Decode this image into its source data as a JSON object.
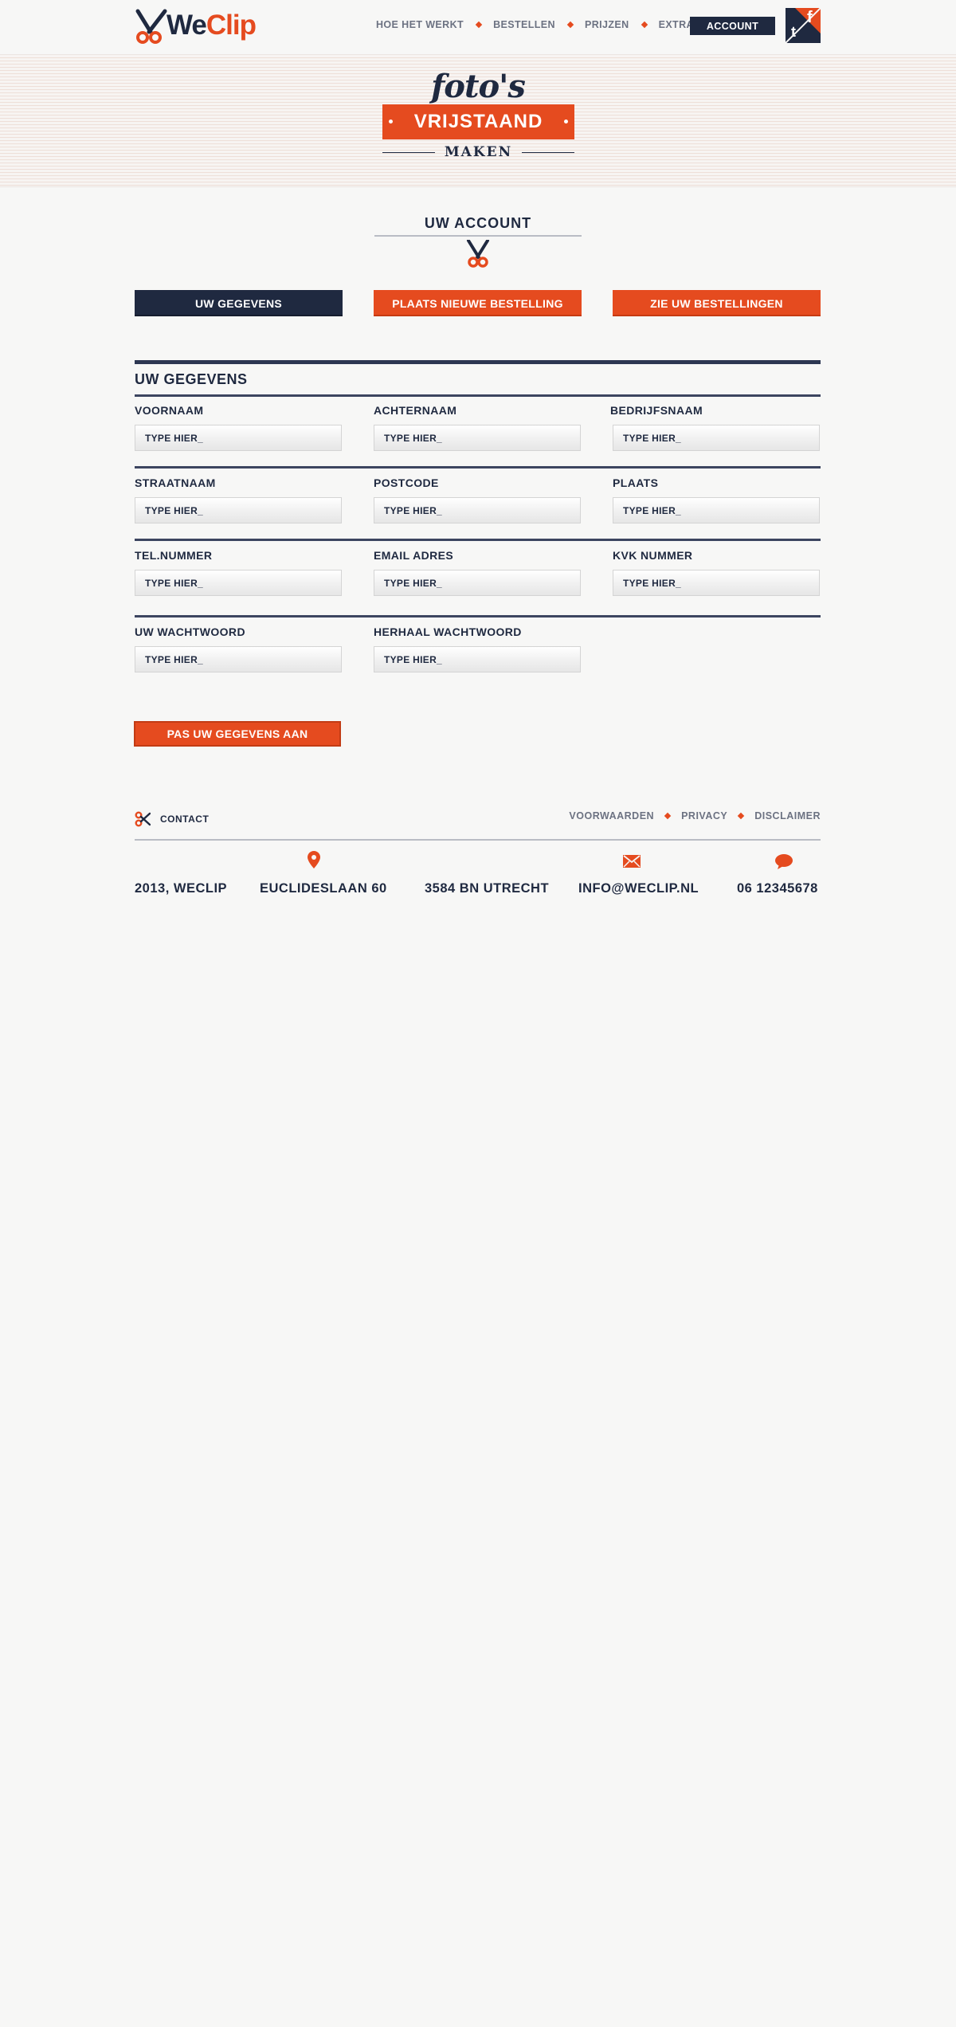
{
  "brand": {
    "logo_we": "We",
    "logo_clip": "Clip"
  },
  "nav": {
    "items": [
      "HOE HET WERKT",
      "BESTELLEN",
      "PRIJZEN",
      "EXTRA"
    ],
    "account": "ACCOUNT"
  },
  "social": {
    "facebook": "f",
    "twitter": "t"
  },
  "hero": {
    "script": "foto's",
    "ribbon": "VRIJSTAAND",
    "sub": "MAKEN"
  },
  "account": {
    "title": "UW ACCOUNT",
    "tabs": [
      "UW GEGEVENS",
      "PLAATS NIEUWE BESTELLING",
      "ZIE UW BESTELLINGEN"
    ]
  },
  "form": {
    "section_title": "UW GEGEVENS",
    "placeholder": "TYPE HIER_",
    "labels": {
      "voornaam": "VOORNAAM",
      "achternaam": "ACHTERNAAM",
      "bedrijfsnaam": "BEDRIJFSNAAM",
      "straatnaam": "STRAATNAAM",
      "postcode": "POSTCODE",
      "plaats": "PLAATS",
      "telnummer": "TEL.NUMMER",
      "email": "EMAIL ADRES",
      "kvk": "KVK NUMMER",
      "wachtwoord": "UW WACHTWOORD",
      "herhaal": "HERHAAL WACHTWOORD"
    },
    "submit": "PAS UW GEGEVENS AAN"
  },
  "footer": {
    "contact": "CONTACT",
    "links": [
      "VOORWAARDEN",
      "PRIVACY",
      "DISCLAIMER"
    ],
    "info": {
      "copyright": "2013, WECLIP",
      "street": "EUCLIDESLAAN 60",
      "city": "3584 BN UTRECHT",
      "email": "INFO@WECLIP.NL",
      "phone": "06 12345678"
    }
  },
  "colors": {
    "navy": "#1f2940",
    "orange": "#e54b1f",
    "grey": "#6c7282"
  }
}
